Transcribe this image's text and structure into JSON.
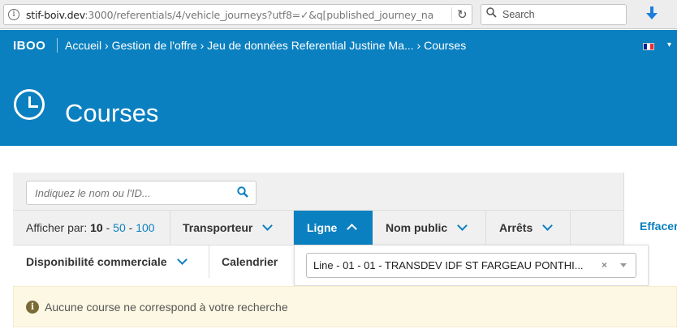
{
  "browser": {
    "url_main": "stif-boiv.dev",
    "url_rest": ":3000/referentials/4/vehicle_journeys?utf8=✓&q[published_journey_na",
    "search_placeholder": "Search",
    "icons": [
      "info-icon",
      "reload-icon",
      "search-icon",
      "download-icon"
    ]
  },
  "navbar": {
    "brand": "IBOO",
    "breadcrumb": "Accueil › Gestion de l'offre › Jeu de données Referential Justine Ma... › Courses",
    "colors": {
      "primary": "#0b80c0"
    }
  },
  "header": {
    "title": "Courses",
    "icon": "clock-icon"
  },
  "filters": {
    "search_placeholder": "Indiquez le nom ou l'ID...",
    "per_page_label": "Afficher par:",
    "per_page_current": "10",
    "per_page_sep1": " - ",
    "per_page_opt1": "50",
    "per_page_sep2": " - ",
    "per_page_opt2": "100",
    "tabs": {
      "transporteur": "Transporteur",
      "ligne": "Ligne",
      "nom_public": "Nom public",
      "arrets": "Arrêts",
      "disponibilite": "Disponibilité commerciale",
      "calendrier": "Calendrier"
    },
    "clear_label": "Effacer",
    "ligne_selected": "Line - 01 - 01 - TRANSDEV IDF ST FARGEAU PONTHI...",
    "ligne_clear": "×"
  },
  "alert": {
    "icon": "info-circle-icon",
    "message": "Aucune course ne correspond à votre recherche",
    "colors": {
      "background": "#fcf8e3"
    }
  }
}
